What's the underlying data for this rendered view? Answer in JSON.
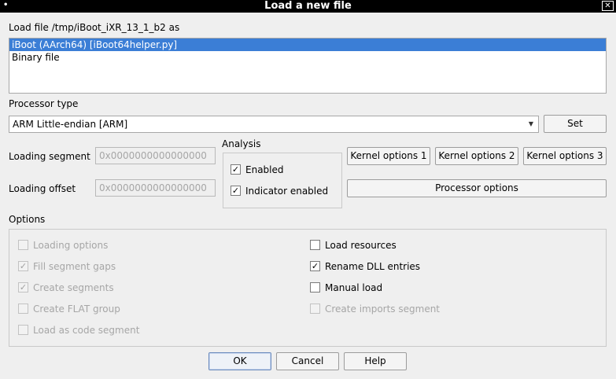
{
  "window": {
    "title": "Load a new file",
    "menu_glyph": "•",
    "close_glyph": "✕"
  },
  "load_file_label": "Load file /tmp/iBoot_iXR_13_1_b2 as",
  "loaders": [
    "iBoot (AArch64) [iBoot64helper.py]",
    "Binary file"
  ],
  "selected_loader": 0,
  "processor": {
    "label": "Processor type",
    "value": "ARM Little-endian [ARM]",
    "arrow_glyph": "▼",
    "set_label": "Set"
  },
  "segment": {
    "label": "Loading segment",
    "value": "0x0000000000000000"
  },
  "offset": {
    "label": "Loading offset",
    "value": "0x0000000000000000"
  },
  "analysis": {
    "title": "Analysis",
    "enabled": {
      "label": "Enabled",
      "checked": true
    },
    "indicator": {
      "label": "Indicator enabled",
      "checked": true
    }
  },
  "kernel_buttons": [
    "Kernel options 1",
    "Kernel options 2",
    "Kernel options 3"
  ],
  "processor_options_label": "Processor options",
  "options": {
    "title": "Options",
    "left": [
      {
        "label": "Loading options",
        "checked": false,
        "disabled": true
      },
      {
        "label": "Fill segment gaps",
        "checked": true,
        "disabled": true
      },
      {
        "label": "Create segments",
        "checked": true,
        "disabled": true
      },
      {
        "label": "Create FLAT group",
        "checked": false,
        "disabled": true
      },
      {
        "label": "Load as code segment",
        "checked": false,
        "disabled": true
      }
    ],
    "right": [
      {
        "label": "Load resources",
        "checked": false,
        "disabled": false
      },
      {
        "label": "Rename DLL entries",
        "checked": true,
        "disabled": false
      },
      {
        "label": "Manual load",
        "checked": false,
        "disabled": false
      },
      {
        "label": "Create imports segment",
        "checked": false,
        "disabled": true
      }
    ]
  },
  "check_glyph": "✓",
  "buttons": {
    "ok": "OK",
    "cancel": "Cancel",
    "help": "Help"
  }
}
